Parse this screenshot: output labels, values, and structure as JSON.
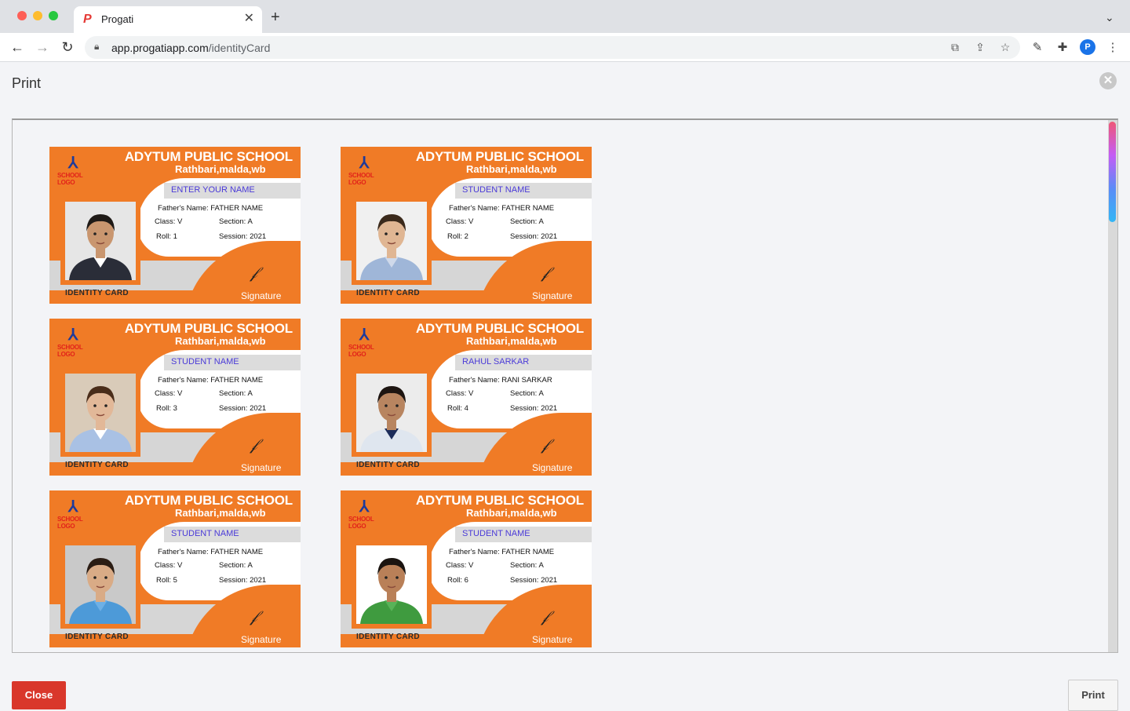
{
  "browser": {
    "tab_title": "Progati",
    "tab_favicon": "P",
    "url_host": "app.progatiapp.com",
    "url_path": "/identityCard",
    "profile_initial": "P"
  },
  "dialog": {
    "title": "Print",
    "close_label": "Close",
    "print_label": "Print"
  },
  "card_template": {
    "school_name": "ADYTUM PUBLIC SCHOOL",
    "school_address": "Rathbari,malda,wb",
    "logo_text": "SCHOOL LOGO",
    "footer_label": "IDENTITY CARD",
    "signature_label": "Signature"
  },
  "cards": [
    {
      "name": "ENTER YOUR NAME",
      "father": "Father's Name: FATHER NAME",
      "class": "Class: V",
      "section": "Section: A",
      "roll": "Roll: 1",
      "session": "Session: 2021",
      "photo": {
        "bg": "#e6e6e6",
        "skin": "#c9966f",
        "hair": "#1f1a17",
        "shirt": "#2a2d38",
        "collar": "#ffffff"
      }
    },
    {
      "name": "STUDENT NAME",
      "father": "Father's Name: FATHER NAME",
      "class": "Class: V",
      "section": "Section: A",
      "roll": "Roll: 2",
      "session": "Session: 2021",
      "photo": {
        "bg": "#f0f0f0",
        "skin": "#e0b693",
        "hair": "#3b2a1c",
        "shirt": "#9fb6d8",
        "collar": "#cfd9ea"
      }
    },
    {
      "name": "STUDENT NAME",
      "father": "Father's Name: FATHER NAME",
      "class": "Class: V",
      "section": "Section: A",
      "roll": "Roll: 3",
      "session": "Session: 2021",
      "photo": {
        "bg": "#d9cbb9",
        "skin": "#e2b898",
        "hair": "#4a2d1a",
        "shirt": "#a9c1e4",
        "collar": "#ffffff"
      }
    },
    {
      "name": "RAHUL SARKAR",
      "father": "Father's Name: RANI SARKAR",
      "class": "Class: V",
      "section": "Section: A",
      "roll": "Roll: 4",
      "session": "Session: 2021",
      "photo": {
        "bg": "#ececec",
        "skin": "#b88560",
        "hair": "#1d1511",
        "shirt": "#dfe6ef",
        "collar": "#1c2c5a"
      }
    },
    {
      "name": "STUDENT NAME",
      "father": "Father's Name: FATHER NAME",
      "class": "Class: V",
      "section": "Section: A",
      "roll": "Roll: 5",
      "session": "Session: 2021",
      "photo": {
        "bg": "#c9c9c9",
        "skin": "#d9ab86",
        "hair": "#2b1d14",
        "shirt": "#4d9ad8",
        "collar": "#6db0e6"
      }
    },
    {
      "name": "STUDENT NAME",
      "father": "Father's Name: FATHER NAME",
      "class": "Class: V",
      "section": "Section: A",
      "roll": "Roll: 6",
      "session": "Session: 2021",
      "photo": {
        "bg": "#ffffff",
        "skin": "#b98058",
        "hair": "#1a1410",
        "shirt": "#3f9b3f",
        "collar": "#58b358"
      }
    }
  ],
  "icons": {
    "lock": "lock-icon",
    "back": "arrow-left-icon",
    "forward": "arrow-right-icon",
    "reload": "reload-icon",
    "close": "close-icon"
  }
}
